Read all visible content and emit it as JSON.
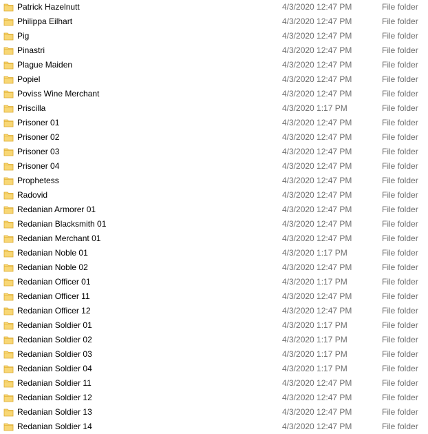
{
  "folder_icon": "folder-icon",
  "colors": {
    "folder_fill": "#F8D775",
    "folder_stroke": "#DCAA2E",
    "secondary_text": "#6D6D6D"
  },
  "rows": [
    {
      "name": "Patrick Hazelnutt",
      "date": "4/3/2020 12:47 PM",
      "type": "File folder"
    },
    {
      "name": "Philippa Eilhart",
      "date": "4/3/2020 12:47 PM",
      "type": "File folder"
    },
    {
      "name": "Pig",
      "date": "4/3/2020 12:47 PM",
      "type": "File folder"
    },
    {
      "name": "Pinastri",
      "date": "4/3/2020 12:47 PM",
      "type": "File folder"
    },
    {
      "name": "Plague Maiden",
      "date": "4/3/2020 12:47 PM",
      "type": "File folder"
    },
    {
      "name": "Popiel",
      "date": "4/3/2020 12:47 PM",
      "type": "File folder"
    },
    {
      "name": "Poviss Wine Merchant",
      "date": "4/3/2020 12:47 PM",
      "type": "File folder"
    },
    {
      "name": "Priscilla",
      "date": "4/3/2020 1:17 PM",
      "type": "File folder"
    },
    {
      "name": "Prisoner 01",
      "date": "4/3/2020 12:47 PM",
      "type": "File folder"
    },
    {
      "name": "Prisoner 02",
      "date": "4/3/2020 12:47 PM",
      "type": "File folder"
    },
    {
      "name": "Prisoner 03",
      "date": "4/3/2020 12:47 PM",
      "type": "File folder"
    },
    {
      "name": "Prisoner 04",
      "date": "4/3/2020 12:47 PM",
      "type": "File folder"
    },
    {
      "name": "Prophetess",
      "date": "4/3/2020 12:47 PM",
      "type": "File folder"
    },
    {
      "name": "Radovid",
      "date": "4/3/2020 12:47 PM",
      "type": "File folder"
    },
    {
      "name": "Redanian Armorer 01",
      "date": "4/3/2020 12:47 PM",
      "type": "File folder"
    },
    {
      "name": "Redanian Blacksmith 01",
      "date": "4/3/2020 12:47 PM",
      "type": "File folder"
    },
    {
      "name": "Redanian Merchant 01",
      "date": "4/3/2020 12:47 PM",
      "type": "File folder"
    },
    {
      "name": "Redanian Noble 01",
      "date": "4/3/2020 1:17 PM",
      "type": "File folder"
    },
    {
      "name": "Redanian Noble 02",
      "date": "4/3/2020 12:47 PM",
      "type": "File folder"
    },
    {
      "name": "Redanian Officer 01",
      "date": "4/3/2020 1:17 PM",
      "type": "File folder"
    },
    {
      "name": "Redanian Officer 11",
      "date": "4/3/2020 12:47 PM",
      "type": "File folder"
    },
    {
      "name": "Redanian Officer 12",
      "date": "4/3/2020 12:47 PM",
      "type": "File folder"
    },
    {
      "name": "Redanian Soldier 01",
      "date": "4/3/2020 1:17 PM",
      "type": "File folder"
    },
    {
      "name": "Redanian Soldier 02",
      "date": "4/3/2020 1:17 PM",
      "type": "File folder"
    },
    {
      "name": "Redanian Soldier 03",
      "date": "4/3/2020 1:17 PM",
      "type": "File folder"
    },
    {
      "name": "Redanian Soldier 04",
      "date": "4/3/2020 1:17 PM",
      "type": "File folder"
    },
    {
      "name": "Redanian Soldier 11",
      "date": "4/3/2020 12:47 PM",
      "type": "File folder"
    },
    {
      "name": "Redanian Soldier 12",
      "date": "4/3/2020 12:47 PM",
      "type": "File folder"
    },
    {
      "name": "Redanian Soldier 13",
      "date": "4/3/2020 12:47 PM",
      "type": "File folder"
    },
    {
      "name": "Redanian Soldier 14",
      "date": "4/3/2020 12:47 PM",
      "type": "File folder"
    }
  ]
}
